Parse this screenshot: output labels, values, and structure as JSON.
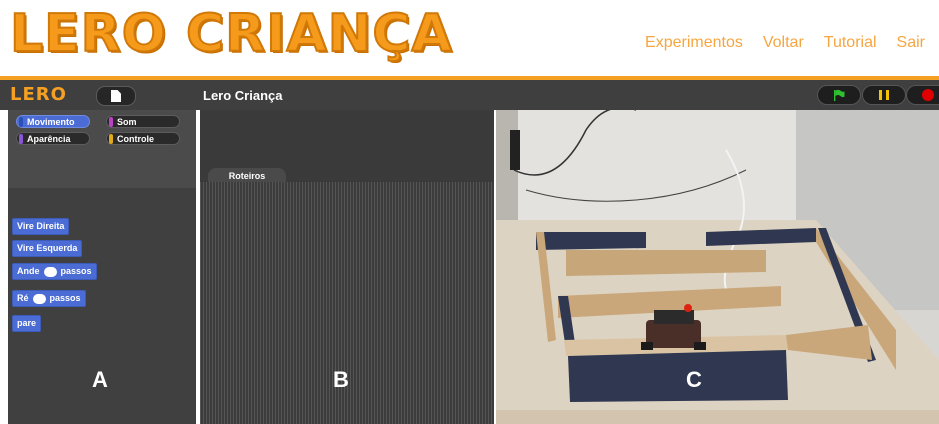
{
  "header": {
    "logo": "LERO CRIANÇA",
    "nav": [
      "Experimentos",
      "Voltar",
      "Tutorial",
      "Sair"
    ]
  },
  "toolbar": {
    "mini_logo": "LERO",
    "project_title": "Lero Criança",
    "flag_color": "#2fbf2f",
    "pause_color": "#f5c400",
    "stop_color": "#e10000"
  },
  "palette": {
    "categories": [
      "Movimento",
      "Som",
      "Aparência",
      "Controle"
    ],
    "blocks": [
      {
        "label": "Vire Direita"
      },
      {
        "label": "Vire Esquerda"
      },
      {
        "label": "Ande",
        "suffix": "passos"
      },
      {
        "label": "Ré",
        "suffix": "passos"
      },
      {
        "label": "pare"
      }
    ]
  },
  "scripts": {
    "tab": "Roteiros"
  },
  "labels": {
    "a": "A",
    "b": "B",
    "c": "C"
  },
  "colors": {
    "accent": "#f5a023",
    "block_blue": "#4a6cd4"
  }
}
